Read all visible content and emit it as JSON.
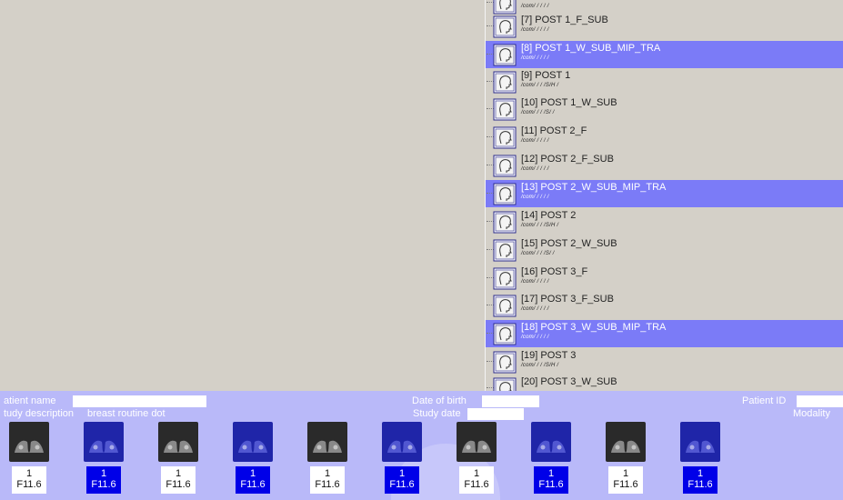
{
  "series_list": [
    {
      "title": "",
      "sub": "/com/ / / / /",
      "selected": false
    },
    {
      "title": "[7] POST 1_F_SUB",
      "sub": "/com/ / / / /",
      "selected": false
    },
    {
      "title": "[8] POST 1_W_SUB_MIP_TRA",
      "sub": "/com/ / / / /",
      "selected": true
    },
    {
      "title": "[9] POST 1",
      "sub": "/com/ / / /S/H /",
      "selected": false
    },
    {
      "title": "[10] POST 1_W_SUB",
      "sub": "/com/ / / /S/ /",
      "selected": false
    },
    {
      "title": "[11] POST 2_F",
      "sub": "/com/ / / / /",
      "selected": false
    },
    {
      "title": "[12] POST 2_F_SUB",
      "sub": "/com/ / / / /",
      "selected": false
    },
    {
      "title": "[13] POST 2_W_SUB_MIP_TRA",
      "sub": "/com/ / / / /",
      "selected": true
    },
    {
      "title": "[14] POST 2",
      "sub": "/com/ / / /S/H /",
      "selected": false
    },
    {
      "title": "[15] POST 2_W_SUB",
      "sub": "/com/ / / /S/ /",
      "selected": false
    },
    {
      "title": "[16] POST 3_F",
      "sub": "/com/ / / / /",
      "selected": false
    },
    {
      "title": "[17] POST 3_F_SUB",
      "sub": "/com/ / / / /",
      "selected": false
    },
    {
      "title": "[18] POST 3_W_SUB_MIP_TRA",
      "sub": "/com/ / / / /",
      "selected": true
    },
    {
      "title": "[19] POST 3",
      "sub": "/com/ / / /S/H /",
      "selected": false
    },
    {
      "title": "[20] POST 3_W_SUB",
      "sub": "",
      "selected": false
    }
  ],
  "info": {
    "patient_name_label": "atient name",
    "date_of_birth_label": "Date of birth",
    "patient_id_label": "Patient ID",
    "study_description_label": "tudy description",
    "study_description_value": "breast routine dot",
    "study_date_label": "Study date",
    "modality_label": "Modality"
  },
  "thumbnails": [
    {
      "line1": "1",
      "line2": "F11.6",
      "style": "dark"
    },
    {
      "line1": "1",
      "line2": "F11.6",
      "style": "blue"
    },
    {
      "line1": "1",
      "line2": "F11.6",
      "style": "dark"
    },
    {
      "line1": "1",
      "line2": "F11.6",
      "style": "blue"
    },
    {
      "line1": "1",
      "line2": "F11.6",
      "style": "dark"
    },
    {
      "line1": "1",
      "line2": "F11.6",
      "style": "blue"
    },
    {
      "line1": "1",
      "line2": "F11.6",
      "style": "dark"
    },
    {
      "line1": "1",
      "line2": "F11.6",
      "style": "blue"
    },
    {
      "line1": "1",
      "line2": "F11.6",
      "style": "dark"
    },
    {
      "line1": "1",
      "line2": "F11.6",
      "style": "blue"
    }
  ],
  "colors": {
    "selection": "#7b7bf7",
    "info_bar": "#b9b9f9",
    "thumb_blue_label": "#0000e8",
    "panel_bg": "#d4d0c8"
  },
  "icons": {
    "series_icon": "head-profile-icon"
  }
}
